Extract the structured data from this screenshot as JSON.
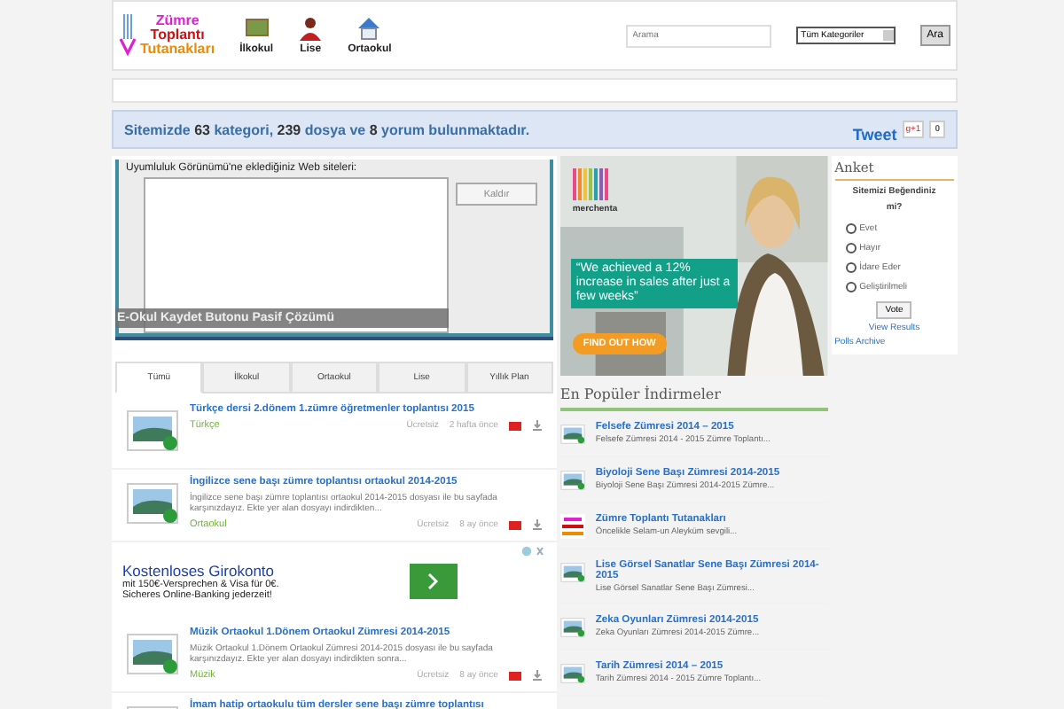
{
  "header": {
    "logo": [
      "Zümre",
      "Toplantı",
      "Tutanakları"
    ],
    "nav": [
      {
        "label": "İlkokul",
        "kind": "board"
      },
      {
        "label": "Lise",
        "kind": "person"
      },
      {
        "label": "Ortaokul",
        "kind": "house"
      }
    ],
    "search": {
      "placeholder": "Arama"
    },
    "category_select": "Tüm Kategoriler",
    "search_button": "Ara"
  },
  "stats": {
    "text": "Sitemizde **63** kategori, **239** dosya ve **8** yorum bulunmaktadır.",
    "tweet": "Tweet",
    "gplus": "g+1",
    "gplus_count": "0"
  },
  "slider": {
    "dialog_label": "Uyumluluk Görünümü'ne eklediğiniz Web siteleri:",
    "dialog_button": "Kaldır",
    "caption": "E-Okul Kaydet Butonu Pasif Çözümü"
  },
  "tabs": [
    {
      "label": "Tümü",
      "selected": true
    },
    {
      "label": "İlkokul",
      "selected": false
    },
    {
      "label": "Ortaokul",
      "selected": false
    },
    {
      "label": "Lise",
      "selected": false
    },
    {
      "label": "Yıllık Plan",
      "selected": false
    }
  ],
  "files": [
    {
      "kind": "file",
      "title": "Türkçe dersi 2.dönem 1.zümre öğretmenler toplantısı 2015",
      "category": "Türkçe",
      "price": "Ücretsiz",
      "time": "2 hafta önce"
    },
    {
      "kind": "file",
      "title": "İngilizce sene başı zümre toplantısı ortaokul 2014-2015",
      "description": "İngilizce sene başı zümre toplantısı ortaokul 2014-2015 dosyası ile bu sayfada karşınızdayız. Ekte yer alan dosyayı indirdikten...",
      "category": "Ortaokul",
      "price": "Ücretsiz",
      "time": "8 ay önce"
    },
    {
      "kind": "ad",
      "title": "Kostenloses Girokonto",
      "lines": [
        "mit 150€-Versprechen & Visa für 0€.",
        "Sicheres Online-Banking jederzeit!"
      ]
    },
    {
      "kind": "file",
      "title": "Müzik Ortaokul 1.Dönem Ortaokul Zümresi 2014-2015",
      "description": "Müzik Ortaokul 1.Dönem Ortaokul Zümresi 2014-2015 dosyası ile bu sayfada karşınızdayız. Ekte yer alan dosyayı indirdikten sonra...",
      "category": "Müzik",
      "price": "Ücretsiz",
      "time": "8 ay önce"
    },
    {
      "kind": "file",
      "title": "İmam hatip ortaokulu tüm dersler sene başı zümre toplantısı"
    }
  ],
  "banner": {
    "brand": "merchenta",
    "quote": "“We achieved a 12% increase in sales after just a few weeks”",
    "cta": "FIND OUT HOW"
  },
  "popular": {
    "title": "En Popüler İndirmeler",
    "items": [
      {
        "kind": "file",
        "title": "Felsefe Zümresi 2014 – 2015",
        "description": "Felsefe Zümresi 2014 - 2015 Zümre Toplantı..."
      },
      {
        "kind": "file",
        "title": "Biyoloji Sene Başı Zümresi 2014-2015",
        "description": "Biyoloji Sene Başı Zümresi 2014-2015 Zümre..."
      },
      {
        "kind": "logo",
        "title": "Zümre Toplantı Tutanakları",
        "description": "Öncelikle Selam-un Aleyküm sevgili..."
      },
      {
        "kind": "file",
        "title": "Lise Görsel Sanatlar Sene Başı Zümresi 2014-2015",
        "description": "Lise Görsel Sanatlar Sene Başı Zümresi..."
      },
      {
        "kind": "file",
        "title": "Zeka Oyunları Zümresi 2014-2015",
        "description": "Zeka Oyunları Zümresi 2014-2015 Zümre..."
      },
      {
        "kind": "file",
        "title": "Tarih Zümresi 2014 – 2015",
        "description": "Tarih Zümresi 2014 - 2015 Zümre Toplantı..."
      }
    ]
  },
  "poll": {
    "title": "Anket",
    "question": "Sitemizi Beğendiniz mi?",
    "options": [
      {
        "label": "Evet",
        "selected": false
      },
      {
        "label": "Hayır",
        "selected": false
      },
      {
        "label": "İdare Eder",
        "selected": false
      },
      {
        "label": "Geliştirilmeli",
        "selected": false
      }
    ],
    "vote": "Vote",
    "results": "View Results",
    "archive": "Polls Archive"
  }
}
